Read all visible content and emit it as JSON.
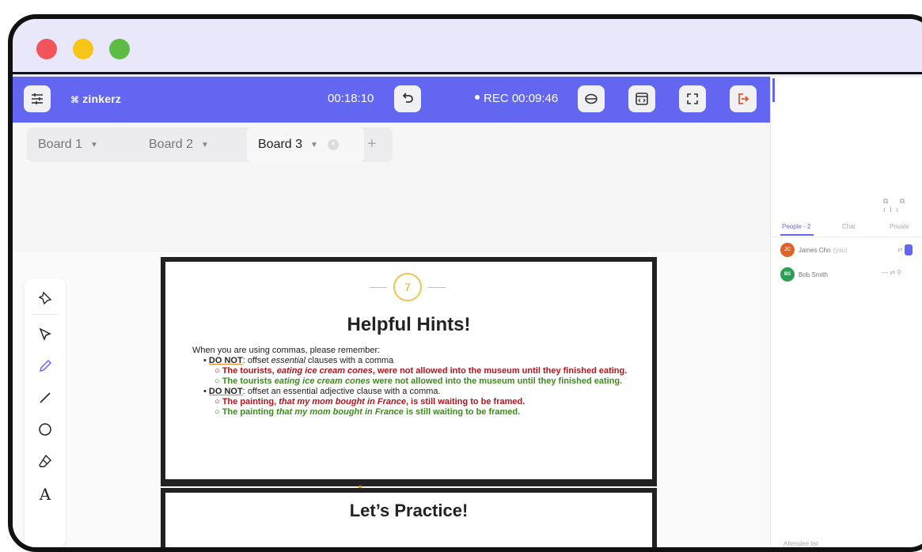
{
  "window": {
    "controls": [
      "close",
      "minimize",
      "maximize"
    ]
  },
  "topbar": {
    "logo_mark": "⌘",
    "logo_text": "zinkerz",
    "session_timer": "00:18:10",
    "recording": "REC 00:09:46",
    "accent": "#6366f1"
  },
  "tabs": [
    {
      "label": "Board 1",
      "active": false
    },
    {
      "label": "Board 2",
      "active": false
    },
    {
      "label": "Board 3",
      "active": true
    }
  ],
  "tab_add": "+",
  "tab_caret": "▼",
  "tab_close": "×",
  "tools": [
    "pin-icon",
    "select-icon",
    "pen-icon",
    "line-icon",
    "circle-icon",
    "eraser-icon",
    "text-icon"
  ],
  "text_tool_glyph": "A",
  "slide": {
    "number": "7",
    "title": "Helpful Hints!",
    "intro": "When you are using commas, please remember:",
    "rule1_dn": "DO NOT",
    "rule1_pre": ": offset ",
    "rule1_em": "essential",
    "rule1_post": " clauses with a comma",
    "ex1_red_a": "The tourists, ",
    "ex1_red_em": "eating ice cream cones",
    "ex1_red_b": ", were not allowed into the museum until they finished eating.",
    "ex1_green_a": "The tourists ",
    "ex1_green_em": "eating ice cream cones",
    "ex1_green_b": " were not allowed into the museum until they finished eating.",
    "rule2_dn": "DO NOT",
    "rule2_rest": ": offset an essential adjective clause with a comma.",
    "ex2_red_a": "The painting, ",
    "ex2_red_em": "that my mom bought in France",
    "ex2_red_b": ", is still waiting to be framed.",
    "ex2_green_a": "The painting ",
    "ex2_green_em": "that my mom bought in France",
    "ex2_green_b": " is still waiting to be framed."
  },
  "slide2": {
    "title": "Let’s Practice!"
  },
  "sidebar": {
    "icons": "⧉ ⧉ ılı",
    "tabs": [
      "People · 2",
      "Chat",
      "Private"
    ],
    "people": [
      {
        "initials": "JC",
        "name": "James Cho",
        "tag": "(you)",
        "color": "#e0632a"
      },
      {
        "initials": "BS",
        "name": "Bob Smith",
        "tag": "",
        "color": "#2e9d57"
      }
    ],
    "footer": "Attendee list"
  }
}
